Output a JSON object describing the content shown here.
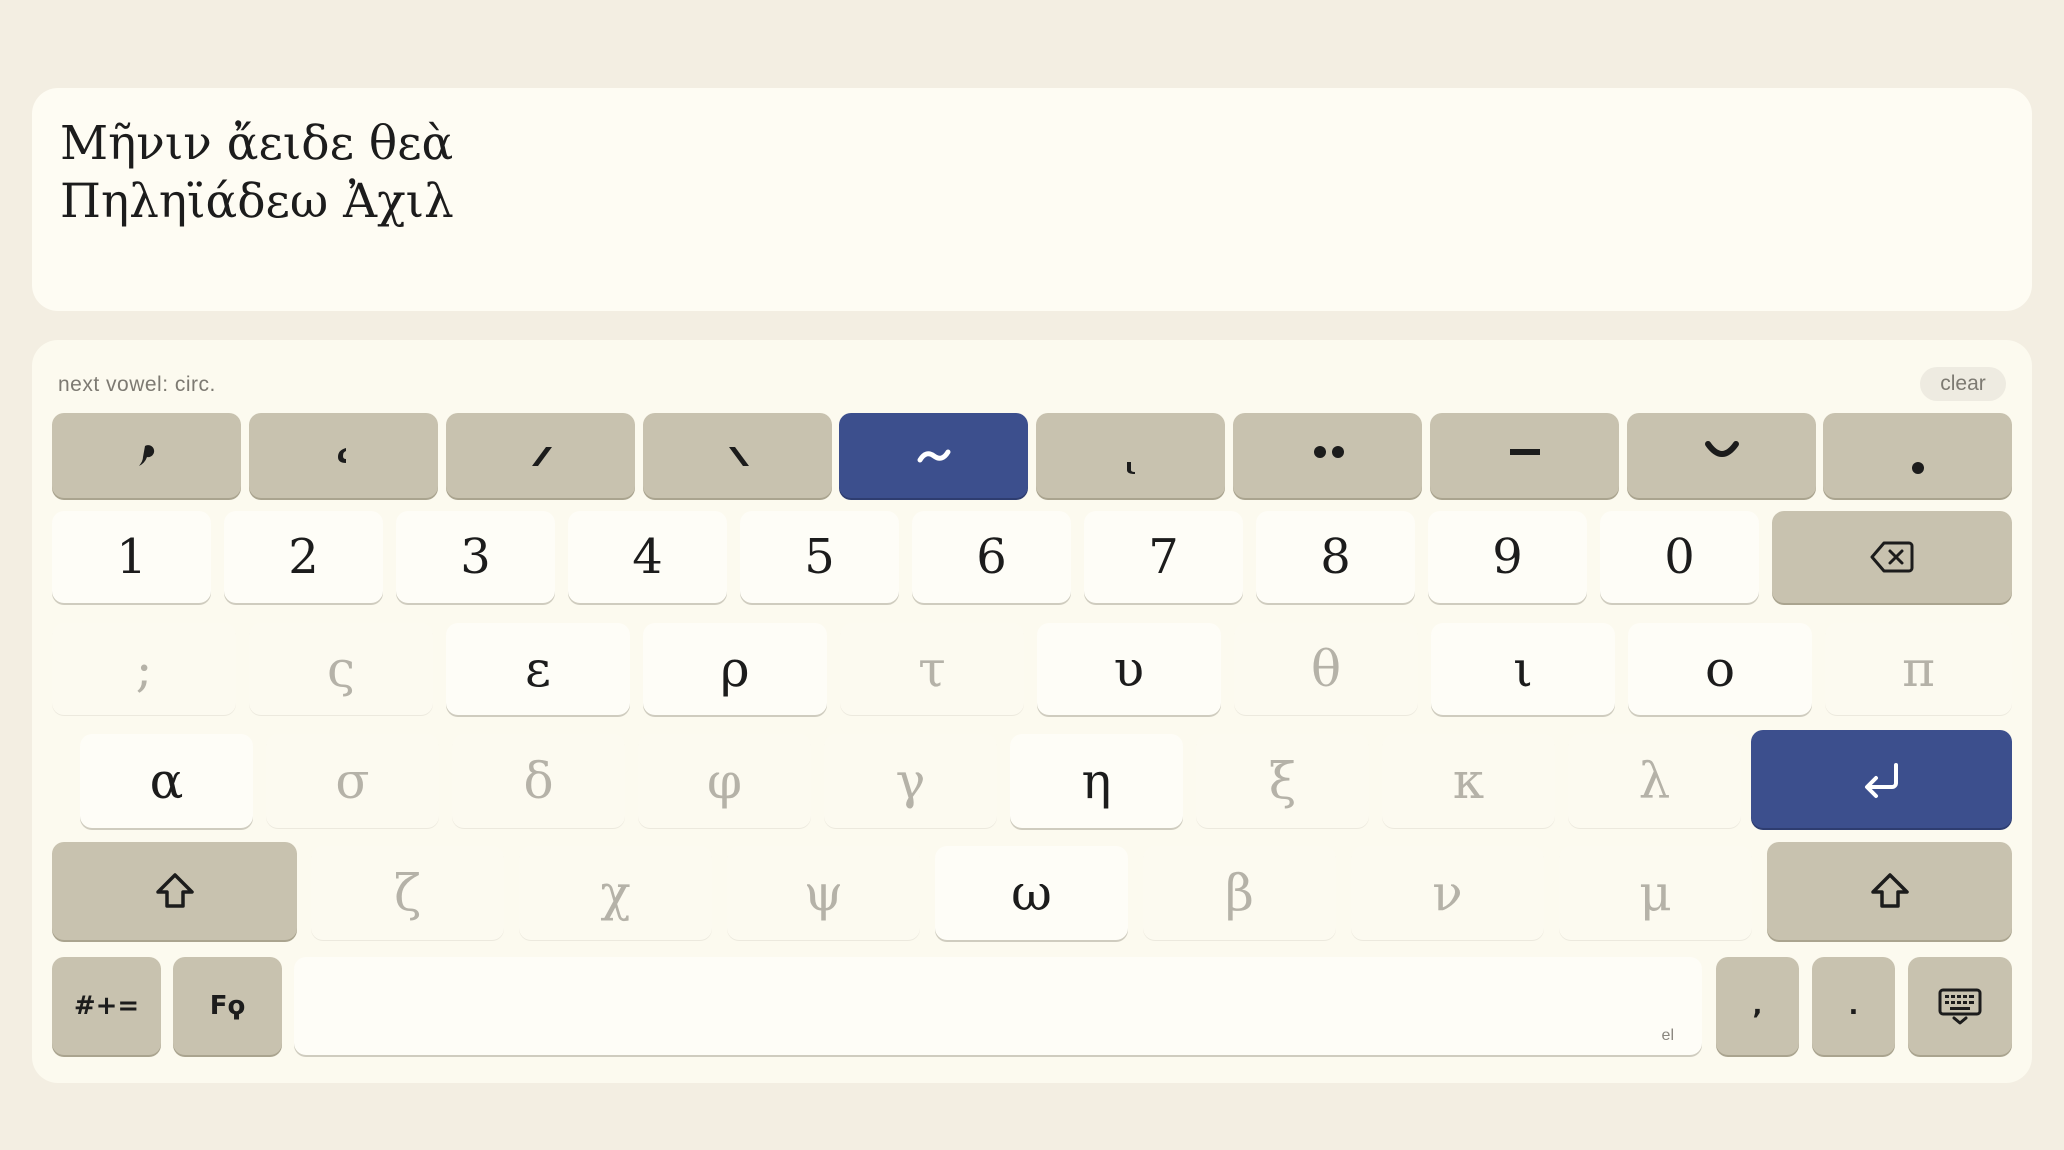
{
  "editor": {
    "line1": "Μῆνιν ἄειδε θεὰ",
    "line2": "Πηληϊάδεω Ἀχιλ"
  },
  "status": {
    "text": "next vowel: circ.",
    "clear_label": "clear"
  },
  "diacritics": [
    {
      "id": "smooth",
      "label": "̓",
      "active": false
    },
    {
      "id": "rough",
      "label": "̔",
      "active": false
    },
    {
      "id": "acute",
      "label": "́",
      "active": false
    },
    {
      "id": "grave",
      "label": "̀",
      "active": false
    },
    {
      "id": "circumflex",
      "label": "~",
      "active": true
    },
    {
      "id": "iota-subscript",
      "label": "ͅ",
      "active": false
    },
    {
      "id": "diaeresis",
      "label": "••",
      "active": false
    },
    {
      "id": "macron",
      "label": "–",
      "active": false
    },
    {
      "id": "breve",
      "label": "̆",
      "active": false
    },
    {
      "id": "dot-below",
      "label": "•",
      "active": false
    }
  ],
  "numbers": [
    "1",
    "2",
    "3",
    "4",
    "5",
    "6",
    "7",
    "8",
    "9",
    "0"
  ],
  "row1": [
    {
      "label": ";",
      "enabled": false
    },
    {
      "label": "ς",
      "enabled": false
    },
    {
      "label": "ε",
      "enabled": true
    },
    {
      "label": "ρ",
      "enabled": true
    },
    {
      "label": "τ",
      "enabled": false
    },
    {
      "label": "υ",
      "enabled": true
    },
    {
      "label": "θ",
      "enabled": false
    },
    {
      "label": "ι",
      "enabled": true
    },
    {
      "label": "ο",
      "enabled": true
    },
    {
      "label": "π",
      "enabled": false
    }
  ],
  "row2": [
    {
      "label": "α",
      "enabled": true
    },
    {
      "label": "σ",
      "enabled": false
    },
    {
      "label": "δ",
      "enabled": false
    },
    {
      "label": "φ",
      "enabled": false
    },
    {
      "label": "γ",
      "enabled": false
    },
    {
      "label": "η",
      "enabled": true
    },
    {
      "label": "ξ",
      "enabled": false
    },
    {
      "label": "κ",
      "enabled": false
    },
    {
      "label": "λ",
      "enabled": false
    }
  ],
  "row3": [
    {
      "label": "ζ",
      "enabled": false
    },
    {
      "label": "χ",
      "enabled": false
    },
    {
      "label": "ψ",
      "enabled": false
    },
    {
      "label": "ω",
      "enabled": true
    },
    {
      "label": "β",
      "enabled": false
    },
    {
      "label": "ν",
      "enabled": false
    },
    {
      "label": "μ",
      "enabled": false
    }
  ],
  "bottom": {
    "symbols_label": "#+=",
    "archaic_label": "Fϙ",
    "space_lang": "el",
    "comma": ",",
    "period": "."
  },
  "icons": {
    "backspace": "backspace-icon",
    "enter": "return-icon",
    "shift": "shift-icon",
    "hide": "keyboard-hide-icon"
  },
  "colors": {
    "accent": "#3c4f8d",
    "modifier": "#c8c2af",
    "background": "#f3eee2"
  }
}
